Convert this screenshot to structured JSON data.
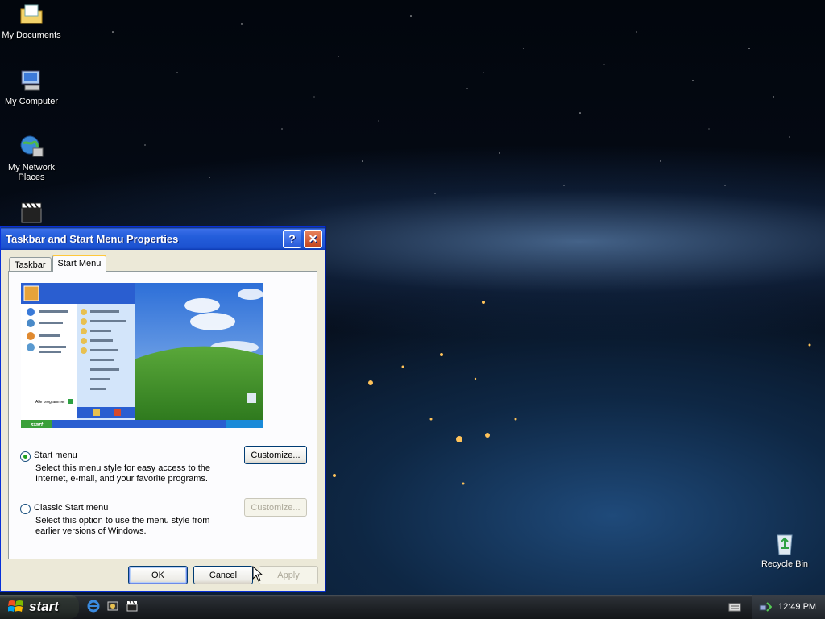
{
  "desktop": {
    "icons": [
      {
        "label": "My Documents"
      },
      {
        "label": "My Computer"
      },
      {
        "label": "My Network Places"
      },
      {
        "label": ""
      },
      {
        "label": "Recycle Bin"
      }
    ]
  },
  "dialog": {
    "title": "Taskbar and Start Menu Properties",
    "help_glyph": "?",
    "close_glyph": "✕",
    "tabs": [
      {
        "label": "Taskbar",
        "active": false
      },
      {
        "label": "Start Menu",
        "active": true
      }
    ],
    "options": [
      {
        "label": "Start menu",
        "selected": true,
        "description": "Select this menu style for easy access to the Internet, e-mail, and your favorite programs.",
        "button": "Customize...",
        "button_enabled": true
      },
      {
        "label": "Classic Start menu",
        "selected": false,
        "description": "Select this option to use the menu style from earlier versions of Windows.",
        "button": "Customize...",
        "button_enabled": false
      }
    ],
    "buttons": {
      "ok": "OK",
      "cancel": "Cancel",
      "apply": "Apply"
    },
    "preview": {
      "start_label": "start",
      "all_programs": "Alle programmer"
    }
  },
  "taskbar": {
    "start_label": "start",
    "clock": "12:49 PM"
  },
  "colors": {
    "dialog_face": "#ece9d8",
    "title_blue": "#245edb",
    "accent_tab": "#ffc83c"
  }
}
